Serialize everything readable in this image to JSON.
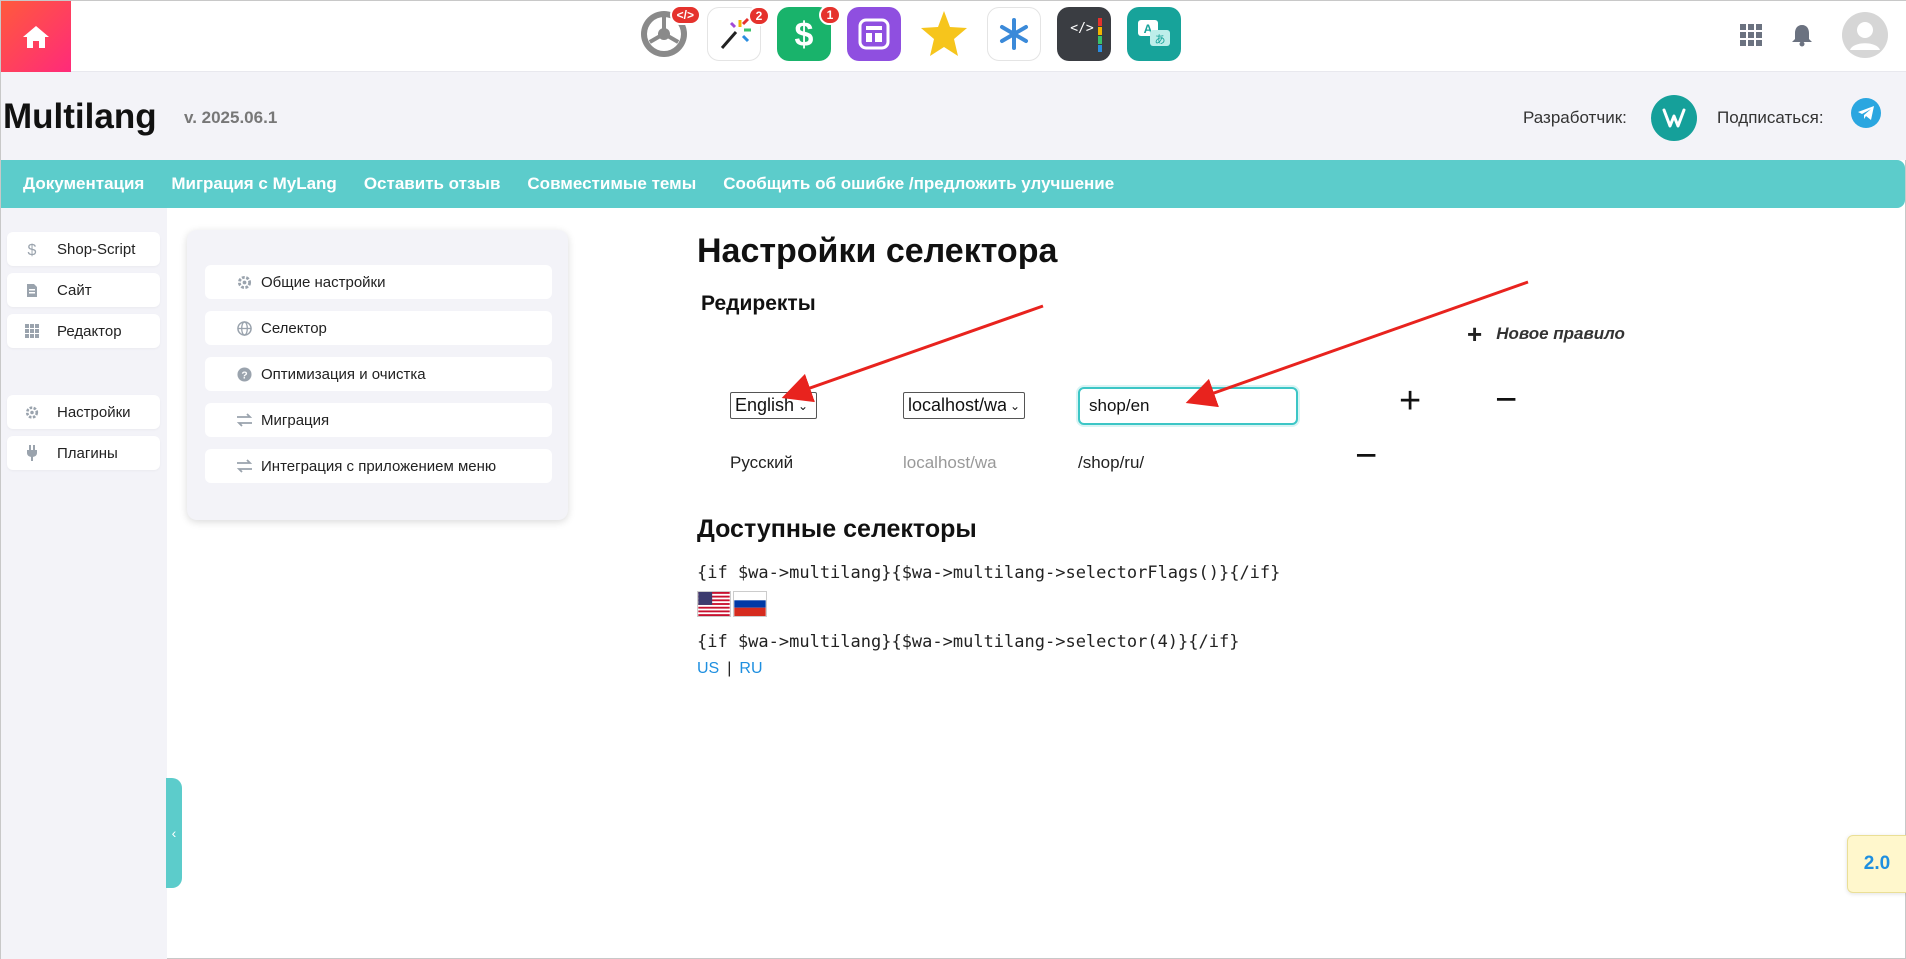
{
  "topbar": {
    "apps": [
      {
        "icon": "wheel-app-icon",
        "badge": "</>"
      },
      {
        "icon": "magic-wand-app-icon",
        "badge": "2"
      },
      {
        "icon": "dollar-app-icon",
        "badge": "1"
      },
      {
        "icon": "site-layout-app-icon",
        "badge": ""
      },
      {
        "icon": "star-app-icon",
        "badge": ""
      },
      {
        "icon": "asterisk-app-icon",
        "badge": ""
      },
      {
        "icon": "code-app-icon",
        "badge": ""
      },
      {
        "icon": "translate-app-icon",
        "badge": ""
      }
    ]
  },
  "header": {
    "title": "Multilang",
    "version": "v. 2025.06.1",
    "developer_label": "Разработчик:",
    "subscribe_label": "Подписаться:"
  },
  "nav": {
    "items": [
      "Документация",
      "Миграция с MyLang",
      "Оставить отзыв",
      "Совместимые темы",
      "Сообщить об ошибке /предложить улучшение"
    ]
  },
  "sidebar": {
    "items": [
      "Shop-Script",
      "Сайт",
      "Редактор",
      "Настройки",
      "Плагины"
    ]
  },
  "settings_menu": {
    "items": [
      "Общие настройки",
      "Селектор",
      "Оптимизация и очистка",
      "Миграция",
      "Интеграция с приложением меню"
    ]
  },
  "main": {
    "title": "Настройки селектора",
    "redirects_title": "Редиректы",
    "new_rule_label": "Новое правило",
    "rule_edit": {
      "language": "English",
      "domain": "localhost/wa",
      "path": "shop/en"
    },
    "rule_existing": {
      "language": "Русский",
      "domain": "localhost/wa",
      "path": "/shop/ru/"
    },
    "available_title": "Доступные селекторы",
    "code_flags": "{if $wa->multilang}{$wa->multilang->selectorFlags()}{/if}",
    "code_selector": "{if $wa->multilang}{$wa->multilang->selector(4)}{/if}",
    "link_us": "US",
    "link_sep": "|",
    "link_ru": "RU"
  },
  "floating_version": "2.0",
  "colors": {
    "accent": "#5ccccb",
    "home_gradient_start": "#ff5a3c",
    "home_gradient_end": "#ff2a7a",
    "arrow": "#e8231e",
    "link": "#1e8fe0"
  }
}
